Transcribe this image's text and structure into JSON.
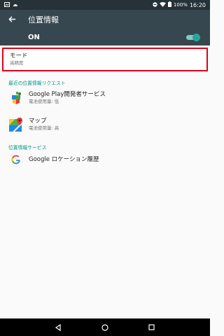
{
  "status_bar": {
    "battery": "100%",
    "time": "16:20"
  },
  "toolbar": {
    "title": "位置情報"
  },
  "switch": {
    "label": "ON",
    "state": "on"
  },
  "mode": {
    "title": "モード",
    "value": "高精度"
  },
  "recent_requests": {
    "header": "最近の位置情報リクエスト",
    "items": [
      {
        "name": "Google Play開発者サービス",
        "battery": "電池使用量: 低",
        "icon": "google-play-services-icon"
      },
      {
        "name": "マップ",
        "battery": "電池使用量: 高",
        "icon": "maps-icon"
      }
    ]
  },
  "location_services": {
    "header": "位置情報サービス",
    "items": [
      {
        "name": "Google ロケーション履歴",
        "icon": "google-g-icon"
      }
    ]
  },
  "colors": {
    "toolbar": "#37474f",
    "status_bar": "#263238",
    "accent": "#009688",
    "highlight": "#e0001a"
  }
}
